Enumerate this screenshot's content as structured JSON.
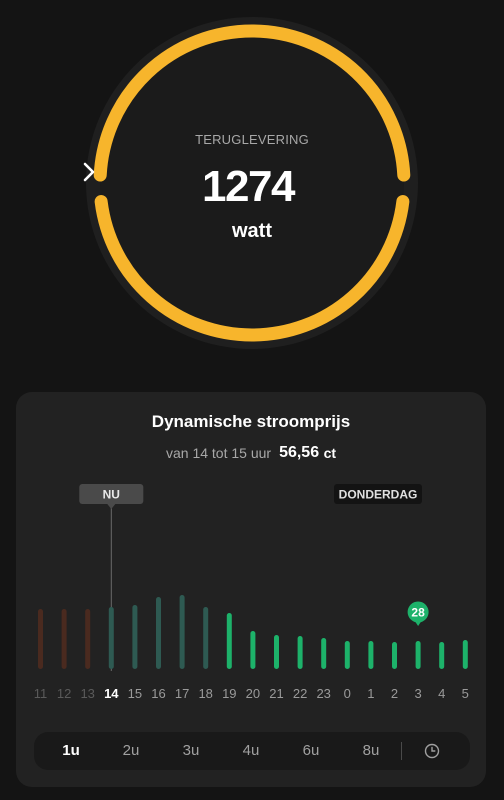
{
  "gauge": {
    "label": "TERUGLEVERING",
    "value": "1274",
    "unit": "watt",
    "accent_color": "#F7B52C",
    "chevron_icon": "chevron-right-icon"
  },
  "price_card": {
    "title": "Dynamische stroomprijs",
    "range_text": "van 14 tot 15 uur",
    "price": "56,56",
    "price_unit": "ct",
    "marker_now": "NU",
    "marker_day": "DONDERDAG",
    "highlight_label": "28"
  },
  "chart_data": {
    "type": "bar",
    "categories": [
      "11",
      "12",
      "13",
      "14",
      "15",
      "16",
      "17",
      "18",
      "19",
      "20",
      "21",
      "22",
      "23",
      "0",
      "1",
      "2",
      "3",
      "4",
      "5"
    ],
    "values": [
      60,
      60,
      60,
      62,
      64,
      72,
      74,
      62,
      56,
      38,
      34,
      33,
      31,
      28,
      28,
      27,
      28,
      27,
      29
    ],
    "current_hour": "14",
    "lowest_hour": "3",
    "colors": {
      "past": "#4A2A1F",
      "current_and_near": "#2E5A52",
      "cheap": "#1DB26A",
      "highlight_bubble": "#1DB26A"
    },
    "groups": [
      "past",
      "past",
      "past",
      "near",
      "near",
      "near",
      "near",
      "near",
      "cheap",
      "cheap",
      "cheap",
      "cheap",
      "cheap",
      "cheap",
      "cheap",
      "cheap",
      "cheap",
      "cheap",
      "cheap"
    ]
  },
  "tabs": {
    "items": [
      "1u",
      "2u",
      "3u",
      "4u",
      "6u",
      "8u"
    ],
    "active": "1u",
    "clock_icon": "clock-icon"
  }
}
